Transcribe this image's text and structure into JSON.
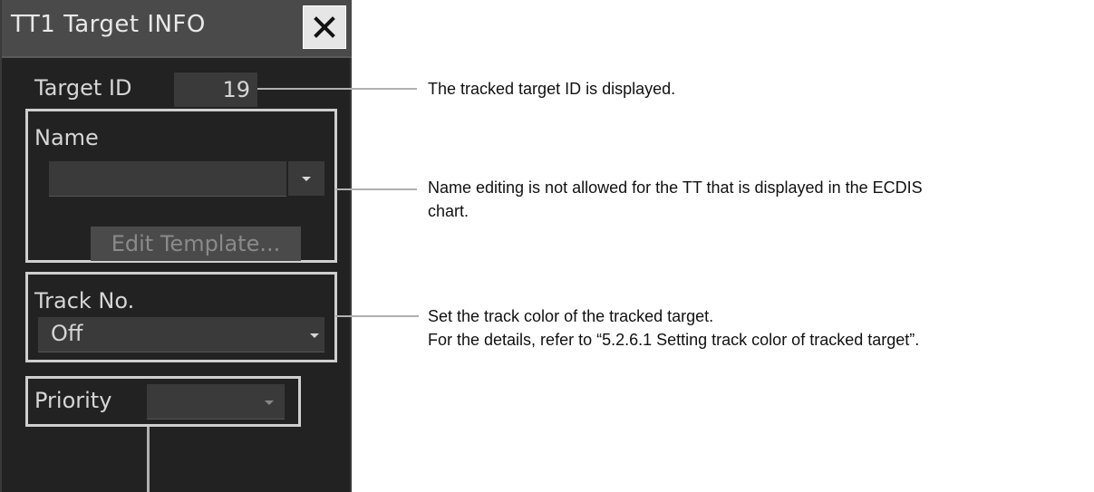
{
  "window": {
    "title": "TT1 Target INFO"
  },
  "target_id": {
    "label": "Target ID",
    "value": "19"
  },
  "name": {
    "label": "Name",
    "value": "",
    "edit_template_label": "Edit Template..."
  },
  "track": {
    "label": "Track No.",
    "value": "Off"
  },
  "priority": {
    "label": "Priority",
    "value": ""
  },
  "annotations": {
    "target_id": "The tracked target ID is displayed.",
    "name_line1": "Name editing is not allowed for the TT that is displayed in the ECDIS",
    "name_line2": "chart.",
    "track_line1": "Set the track color of the tracked target.",
    "track_line2": "For the details, refer to “5.2.6.1 Setting track color of tracked target”."
  },
  "icons": {
    "close": "close-icon",
    "dropdown": "chevron-down-icon"
  },
  "colors": {
    "panel_bg": "#222222",
    "titlebar_bg": "#4a4a4a",
    "field_bg": "#3a3a3a",
    "text": "#d6d6d6",
    "group_border": "#cfcfcf"
  }
}
